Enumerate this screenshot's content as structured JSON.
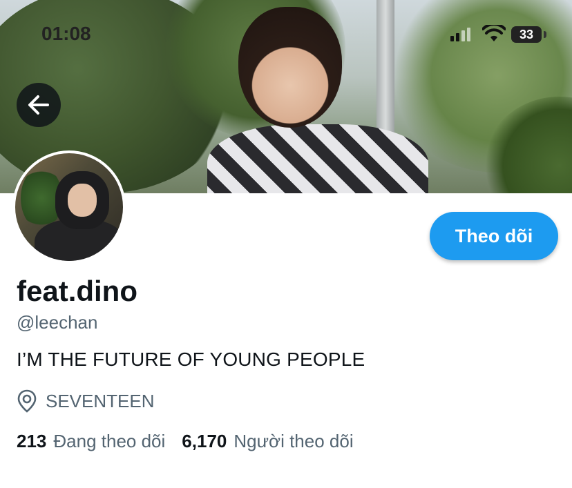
{
  "status_bar": {
    "time": "01:08",
    "battery_percent": "33",
    "signal_bars": 4,
    "signal_bars_active": 2
  },
  "navigation": {
    "back_icon": "arrow-left-icon"
  },
  "profile": {
    "display_name": "feat.dino",
    "handle": "@leechan",
    "bio": "I’M THE FUTURE OF YOUNG PEOPLE",
    "location": "SEVENTEEN",
    "location_icon": "location-pin-icon"
  },
  "actions": {
    "follow_label": "Theo dõi"
  },
  "stats": {
    "following_count": "213",
    "following_label": "Đang theo dõi",
    "followers_count": "6,170",
    "followers_label": "Người theo dõi"
  },
  "colors": {
    "accent": "#1d9bf0",
    "primary_text": "#0f1419",
    "secondary_text": "#536471"
  }
}
